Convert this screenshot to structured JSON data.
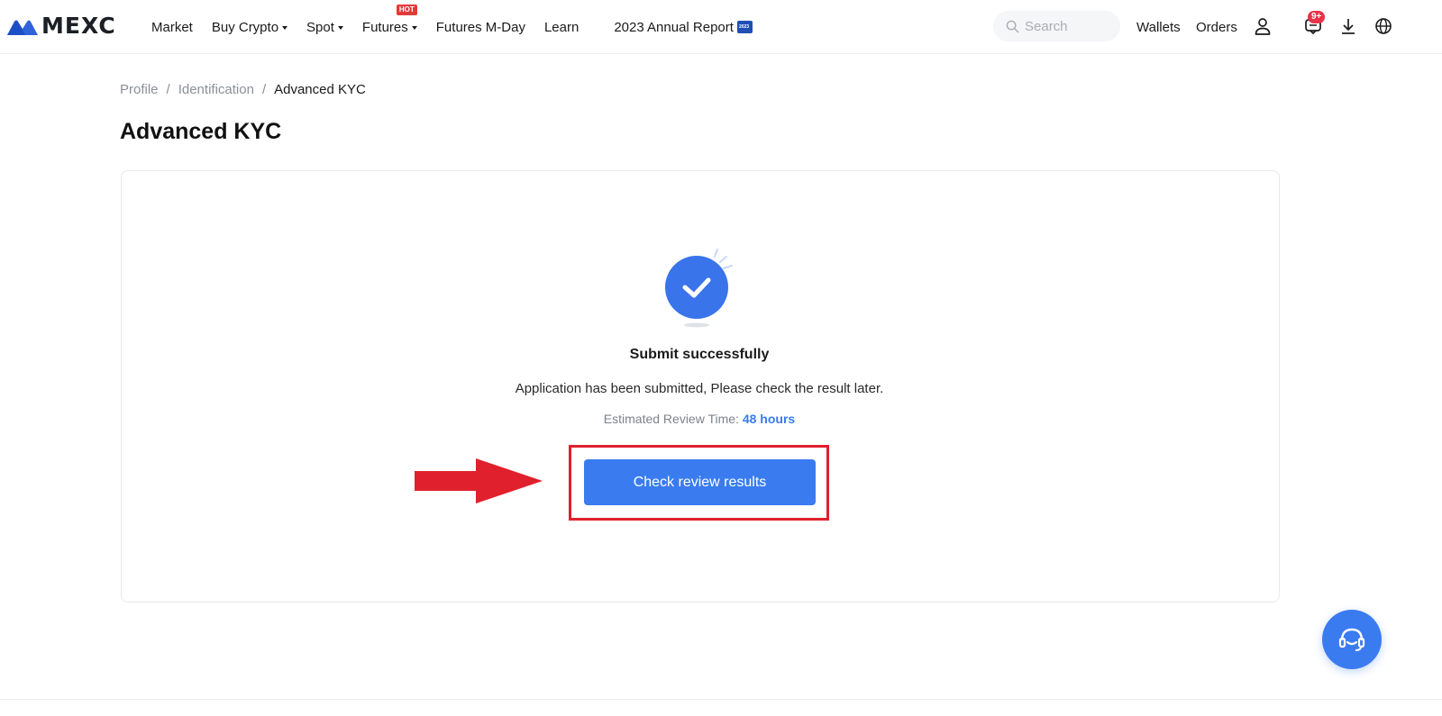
{
  "brand": {
    "name": "MEXC",
    "logo_color": "#2f63d9"
  },
  "nav": {
    "items": [
      {
        "label": "Market",
        "dropdown": false
      },
      {
        "label": "Buy Crypto",
        "dropdown": true
      },
      {
        "label": "Spot",
        "dropdown": true
      },
      {
        "label": "Futures",
        "dropdown": true,
        "badge": "HOT"
      },
      {
        "label": "Futures M-Day",
        "dropdown": false
      },
      {
        "label": "Learn",
        "dropdown": false
      }
    ],
    "annual_report": "2023 Annual Report",
    "annual_icon_text": "2023"
  },
  "header_right": {
    "search_placeholder": "Search",
    "wallets": "Wallets",
    "orders": "Orders",
    "notification_badge": "9+",
    "icons": [
      "user-icon",
      "message-icon",
      "download-icon",
      "globe-icon"
    ]
  },
  "breadcrumb": {
    "items": [
      "Profile",
      "Identification",
      "Advanced KYC"
    ],
    "separator": "/"
  },
  "page": {
    "title": "Advanced KYC"
  },
  "result": {
    "title": "Submit successfully",
    "description": "Application has been submitted, Please check the result later.",
    "review_label": "Estimated Review Time:",
    "review_value": "48 hours",
    "button_label": "Check review results"
  },
  "colors": {
    "accent": "#3a7cf0",
    "highlight": "#e0202c",
    "hot_badge": "#e23a3a"
  }
}
